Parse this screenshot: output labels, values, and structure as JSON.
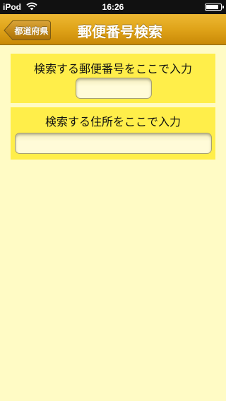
{
  "status_bar": {
    "carrier": "iPod",
    "time": "16:26",
    "battery_level": 0.85
  },
  "nav": {
    "title": "郵便番号検索",
    "back_label": "都道府県"
  },
  "zip_search": {
    "label": "検索する郵便番号をここで入力",
    "value": "",
    "placeholder": ""
  },
  "address_search": {
    "label": "検索する住所をここで入力",
    "value": "",
    "placeholder": ""
  },
  "colors": {
    "background": "#fffbc5",
    "panel": "#ffee4a",
    "nav_bar": "#dfa319"
  },
  "icons": {
    "wifi": "wifi-icon",
    "battery": "battery-icon",
    "back": "back-arrow-button"
  }
}
